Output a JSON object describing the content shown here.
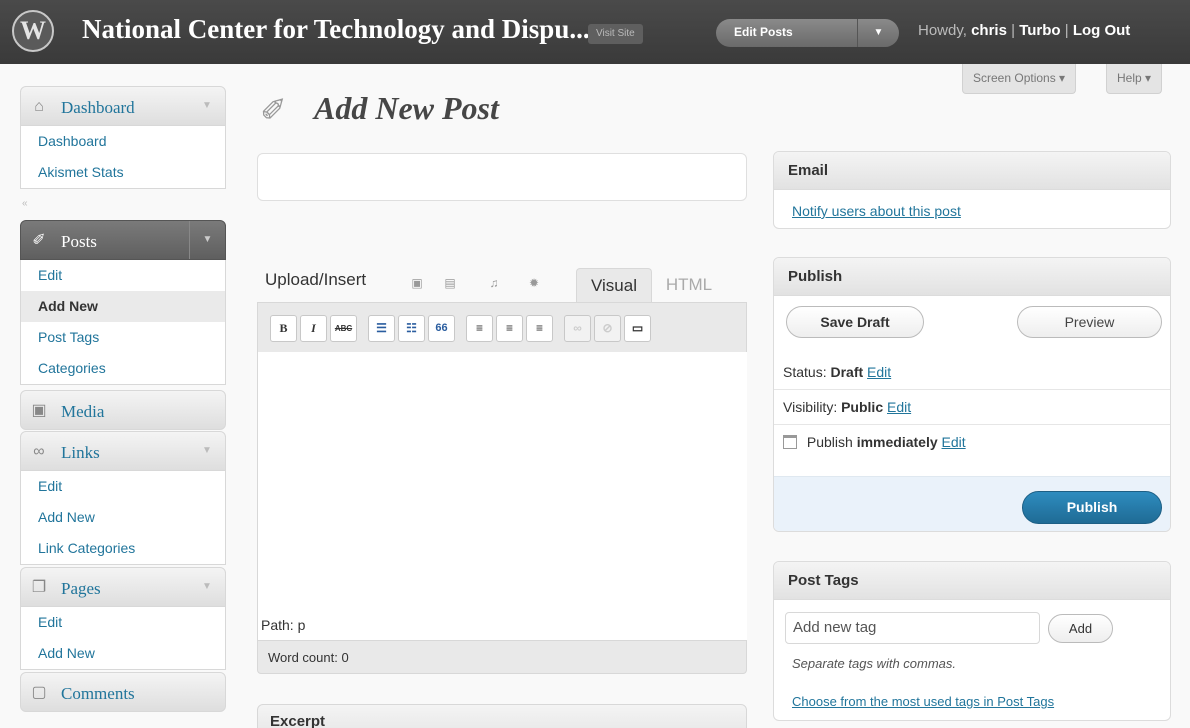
{
  "header": {
    "logo": "W",
    "site_title": "National Center for Technology and Dispu...",
    "visit_site": "Visit Site",
    "favorite_action": "Edit Posts",
    "howdy": "Howdy,",
    "username": "chris",
    "sep1": "|",
    "turbo": "Turbo",
    "sep2": "|",
    "logout": "Log Out"
  },
  "screen_meta": {
    "screen_options": "Screen Options ▾",
    "help": "Help ▾"
  },
  "sidebar": {
    "dashboard": {
      "label": "Dashboard",
      "items": [
        "Dashboard",
        "Akismet Stats"
      ]
    },
    "posts": {
      "label": "Posts",
      "items": [
        "Edit",
        "Add New",
        "Post Tags",
        "Categories"
      ],
      "current": "Add New"
    },
    "media": {
      "label": "Media"
    },
    "links": {
      "label": "Links",
      "items": [
        "Edit",
        "Add New",
        "Link Categories"
      ]
    },
    "pages": {
      "label": "Pages",
      "items": [
        "Edit",
        "Add New"
      ]
    },
    "comments": {
      "label": "Comments"
    }
  },
  "page": {
    "title": "Add New Post"
  },
  "editor": {
    "upload_insert": "Upload/Insert",
    "tab_visual": "Visual",
    "tab_html": "HTML",
    "toolbar": {
      "bold": "B",
      "italic": "I",
      "strike": "ABC",
      "ul": "☰",
      "ol": "☷",
      "quote": "66",
      "align_left": "≡",
      "align_center": "≡",
      "align_right": "≡",
      "link": "∞",
      "unlink": "⊘",
      "more": "▭"
    },
    "path": "Path: p",
    "word_count": "Word count: 0",
    "excerpt_title": "Excerpt"
  },
  "email_box": {
    "title": "Email",
    "link": "Notify users about this post"
  },
  "publish_box": {
    "title": "Publish",
    "save_draft": "Save Draft",
    "preview": "Preview",
    "status_label": "Status:",
    "status_value": "Draft",
    "visibility_label": "Visibility:",
    "visibility_value": "Public",
    "publish_label": "Publish",
    "publish_value": "immediately",
    "edit": "Edit",
    "publish_button": "Publish"
  },
  "tags_box": {
    "title": "Post Tags",
    "placeholder": "Add new tag",
    "add": "Add",
    "hint": "Separate tags with commas.",
    "choose_link": "Choose from the most used tags in Post Tags"
  },
  "colors": {
    "link": "#21759b",
    "publish_button": "#21759b",
    "header_bg": "#464646"
  },
  "icons": {
    "dashboard": "home-icon",
    "posts": "pushpin-icon",
    "media": "media-icon",
    "links": "link-icon",
    "pages": "pages-icon",
    "comments": "comment-bubble-icon"
  }
}
